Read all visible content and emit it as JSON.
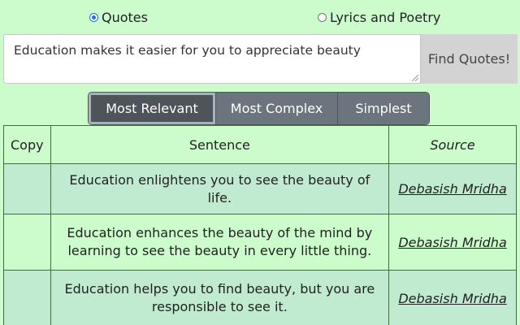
{
  "search_type": {
    "options": [
      {
        "label": "Quotes",
        "checked": true
      },
      {
        "label": "Lyrics and Poetry",
        "checked": false
      }
    ]
  },
  "query": {
    "value": "Education makes it easier for you to appreciate beauty"
  },
  "find_button": {
    "label": "Find Quotes!"
  },
  "sort_options": {
    "relevant": "Most Relevant",
    "complex": "Most Complex",
    "simplest": "Simplest",
    "active": "Most Relevant"
  },
  "table": {
    "headers": {
      "copy": "Copy",
      "sentence": "Sentence",
      "source": "Source"
    },
    "rows": [
      {
        "sentence": "Education enlightens you to see the beauty of life.",
        "source": "Debasish Mridha"
      },
      {
        "sentence": "Education enhances the beauty of the mind by learning to see the beauty in every little thing.",
        "source": "Debasish Mridha"
      },
      {
        "sentence": "Education helps you to find beauty, but you are responsible to see it.",
        "source": "Debasish Mridha"
      }
    ]
  },
  "colors": {
    "page_background": "#ccfccc",
    "row_alt_background": "#c0ebd0",
    "button_gray": "#6c757d",
    "button_active": "#4d545b",
    "find_button_bg": "#d3d3d3",
    "radio_accent": "#1a6fe6"
  }
}
